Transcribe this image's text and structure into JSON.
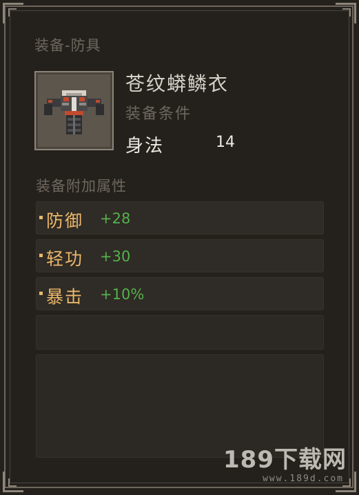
{
  "tooltip": {
    "category": "装备-防具",
    "item_name": "苍纹蟒鳞衣",
    "requirement_title": "装备条件",
    "requirement": {
      "label": "身法",
      "value": "14"
    },
    "attributes_title": "装备附加属性",
    "attributes": [
      {
        "name": "防御",
        "value": "+28"
      },
      {
        "name": "轻功",
        "value": "+30"
      },
      {
        "name": "暴击",
        "value": "+10%"
      }
    ]
  },
  "watermark": {
    "brand": "189下载网",
    "url": "www.189d.com"
  },
  "colors": {
    "background": "#24211d",
    "attribute_name": "#ebb86a",
    "attribute_value": "#54b24a",
    "muted_text": "#6e675e",
    "item_name": "#d6d1c8"
  },
  "icons": {
    "item": "armor-icon"
  }
}
